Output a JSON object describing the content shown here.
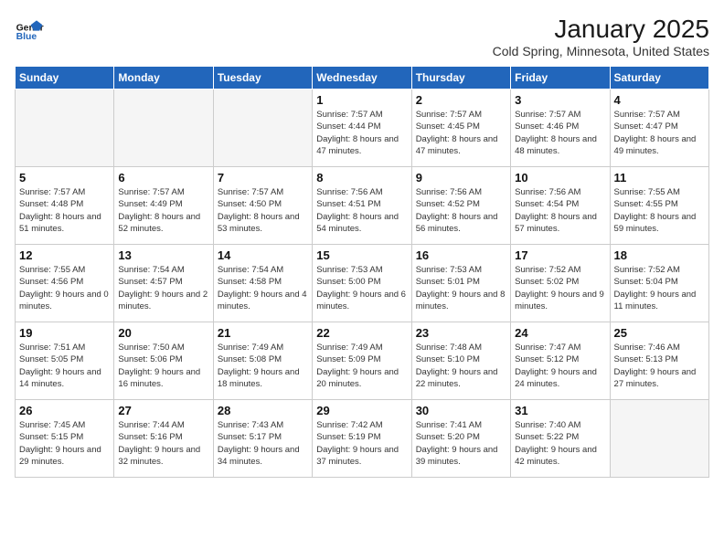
{
  "header": {
    "logo_line1": "General",
    "logo_line2": "Blue",
    "month": "January 2025",
    "location": "Cold Spring, Minnesota, United States"
  },
  "weekdays": [
    "Sunday",
    "Monday",
    "Tuesday",
    "Wednesday",
    "Thursday",
    "Friday",
    "Saturday"
  ],
  "weeks": [
    [
      {
        "day": "",
        "info": ""
      },
      {
        "day": "",
        "info": ""
      },
      {
        "day": "",
        "info": ""
      },
      {
        "day": "1",
        "info": "Sunrise: 7:57 AM\nSunset: 4:44 PM\nDaylight: 8 hours and 47 minutes."
      },
      {
        "day": "2",
        "info": "Sunrise: 7:57 AM\nSunset: 4:45 PM\nDaylight: 8 hours and 47 minutes."
      },
      {
        "day": "3",
        "info": "Sunrise: 7:57 AM\nSunset: 4:46 PM\nDaylight: 8 hours and 48 minutes."
      },
      {
        "day": "4",
        "info": "Sunrise: 7:57 AM\nSunset: 4:47 PM\nDaylight: 8 hours and 49 minutes."
      }
    ],
    [
      {
        "day": "5",
        "info": "Sunrise: 7:57 AM\nSunset: 4:48 PM\nDaylight: 8 hours and 51 minutes."
      },
      {
        "day": "6",
        "info": "Sunrise: 7:57 AM\nSunset: 4:49 PM\nDaylight: 8 hours and 52 minutes."
      },
      {
        "day": "7",
        "info": "Sunrise: 7:57 AM\nSunset: 4:50 PM\nDaylight: 8 hours and 53 minutes."
      },
      {
        "day": "8",
        "info": "Sunrise: 7:56 AM\nSunset: 4:51 PM\nDaylight: 8 hours and 54 minutes."
      },
      {
        "day": "9",
        "info": "Sunrise: 7:56 AM\nSunset: 4:52 PM\nDaylight: 8 hours and 56 minutes."
      },
      {
        "day": "10",
        "info": "Sunrise: 7:56 AM\nSunset: 4:54 PM\nDaylight: 8 hours and 57 minutes."
      },
      {
        "day": "11",
        "info": "Sunrise: 7:55 AM\nSunset: 4:55 PM\nDaylight: 8 hours and 59 minutes."
      }
    ],
    [
      {
        "day": "12",
        "info": "Sunrise: 7:55 AM\nSunset: 4:56 PM\nDaylight: 9 hours and 0 minutes."
      },
      {
        "day": "13",
        "info": "Sunrise: 7:54 AM\nSunset: 4:57 PM\nDaylight: 9 hours and 2 minutes."
      },
      {
        "day": "14",
        "info": "Sunrise: 7:54 AM\nSunset: 4:58 PM\nDaylight: 9 hours and 4 minutes."
      },
      {
        "day": "15",
        "info": "Sunrise: 7:53 AM\nSunset: 5:00 PM\nDaylight: 9 hours and 6 minutes."
      },
      {
        "day": "16",
        "info": "Sunrise: 7:53 AM\nSunset: 5:01 PM\nDaylight: 9 hours and 8 minutes."
      },
      {
        "day": "17",
        "info": "Sunrise: 7:52 AM\nSunset: 5:02 PM\nDaylight: 9 hours and 9 minutes."
      },
      {
        "day": "18",
        "info": "Sunrise: 7:52 AM\nSunset: 5:04 PM\nDaylight: 9 hours and 11 minutes."
      }
    ],
    [
      {
        "day": "19",
        "info": "Sunrise: 7:51 AM\nSunset: 5:05 PM\nDaylight: 9 hours and 14 minutes."
      },
      {
        "day": "20",
        "info": "Sunrise: 7:50 AM\nSunset: 5:06 PM\nDaylight: 9 hours and 16 minutes."
      },
      {
        "day": "21",
        "info": "Sunrise: 7:49 AM\nSunset: 5:08 PM\nDaylight: 9 hours and 18 minutes."
      },
      {
        "day": "22",
        "info": "Sunrise: 7:49 AM\nSunset: 5:09 PM\nDaylight: 9 hours and 20 minutes."
      },
      {
        "day": "23",
        "info": "Sunrise: 7:48 AM\nSunset: 5:10 PM\nDaylight: 9 hours and 22 minutes."
      },
      {
        "day": "24",
        "info": "Sunrise: 7:47 AM\nSunset: 5:12 PM\nDaylight: 9 hours and 24 minutes."
      },
      {
        "day": "25",
        "info": "Sunrise: 7:46 AM\nSunset: 5:13 PM\nDaylight: 9 hours and 27 minutes."
      }
    ],
    [
      {
        "day": "26",
        "info": "Sunrise: 7:45 AM\nSunset: 5:15 PM\nDaylight: 9 hours and 29 minutes."
      },
      {
        "day": "27",
        "info": "Sunrise: 7:44 AM\nSunset: 5:16 PM\nDaylight: 9 hours and 32 minutes."
      },
      {
        "day": "28",
        "info": "Sunrise: 7:43 AM\nSunset: 5:17 PM\nDaylight: 9 hours and 34 minutes."
      },
      {
        "day": "29",
        "info": "Sunrise: 7:42 AM\nSunset: 5:19 PM\nDaylight: 9 hours and 37 minutes."
      },
      {
        "day": "30",
        "info": "Sunrise: 7:41 AM\nSunset: 5:20 PM\nDaylight: 9 hours and 39 minutes."
      },
      {
        "day": "31",
        "info": "Sunrise: 7:40 AM\nSunset: 5:22 PM\nDaylight: 9 hours and 42 minutes."
      },
      {
        "day": "",
        "info": ""
      }
    ]
  ]
}
